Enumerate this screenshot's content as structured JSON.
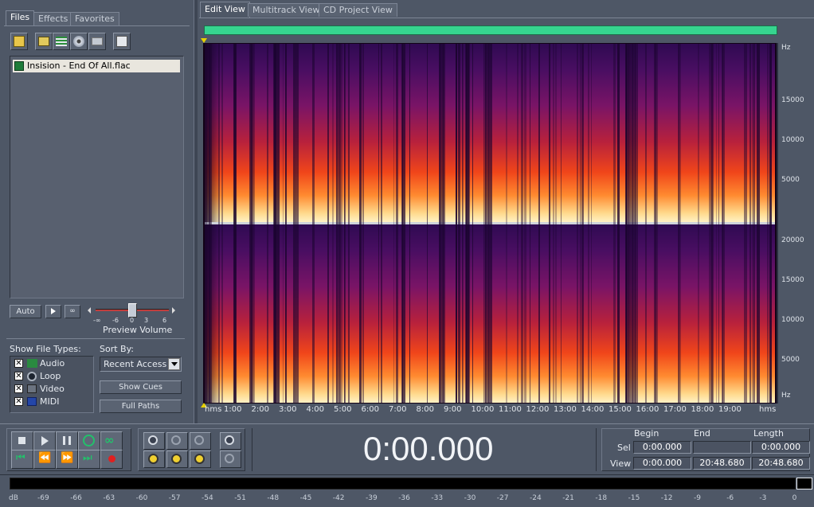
{
  "left_panel": {
    "tabs": [
      "Files",
      "Effects",
      "Favorites"
    ],
    "toolbar_icons": [
      "open-file-icon",
      "close-file-icon",
      "insert-into-multitrack-icon",
      "import-cd-icon",
      "edit-file-icon",
      "auto-play-icon"
    ],
    "files": [
      {
        "name": "Insision - End Of All.flac",
        "type_icon": "audio-waveform-icon"
      }
    ],
    "auto_button": "Auto",
    "preview_volume_label": "Preview Volume",
    "volume_scale": [
      "-∞",
      "-6",
      "0",
      "3",
      "6"
    ],
    "show_file_types_label": "Show File Types:",
    "file_types": [
      {
        "label": "Audio",
        "checked": true,
        "icon": "audio-type-icon"
      },
      {
        "label": "Loop",
        "checked": true,
        "icon": "loop-type-icon"
      },
      {
        "label": "Video",
        "checked": true,
        "icon": "video-type-icon"
      },
      {
        "label": "MIDI",
        "checked": true,
        "icon": "midi-type-icon"
      }
    ],
    "sort_by_label": "Sort By:",
    "sort_by_value": "Recent Access",
    "show_cues_button": "Show Cues",
    "full_paths_button": "Full Paths"
  },
  "view_tabs": [
    "Edit View",
    "Multitrack View",
    "CD Project View"
  ],
  "active_view": "Edit View",
  "spectrogram": {
    "freq_unit": "Hz",
    "top_channel_ticks": [
      "15000",
      "10000",
      "5000"
    ],
    "bottom_channel_ticks": [
      "20000",
      "15000",
      "10000",
      "5000"
    ],
    "time_unit": "hms",
    "time_ticks": [
      "1:00",
      "2:00",
      "3:00",
      "4:00",
      "5:00",
      "6:00",
      "7:00",
      "8:00",
      "9:00",
      "10:00",
      "11:00",
      "12:00",
      "13:00",
      "14:00",
      "15:00",
      "16:00",
      "17:00",
      "18:00",
      "19:00"
    ]
  },
  "transport": {
    "buttons": [
      "stop",
      "play",
      "pause",
      "play-to-end",
      "loop",
      "go-to-beginning",
      "rewind",
      "fast-forward",
      "go-to-end",
      "record"
    ]
  },
  "zoom": {
    "buttons": [
      "zoom-in-horizontal",
      "zoom-out-horizontal",
      "zoom-out-full",
      "zoom-in-vertical",
      "zoom-to-left",
      "zoom-to-right",
      "zoom-to-selection",
      "zoom-out-vertical"
    ]
  },
  "time_display": "0:00.000",
  "selection": {
    "headers": [
      "Begin",
      "End",
      "Length"
    ],
    "sel_label": "Sel",
    "view_label": "View",
    "sel": {
      "begin": "0:00.000",
      "end": "",
      "length": "0:00.000"
    },
    "view": {
      "begin": "0:00.000",
      "end": "20:48.680",
      "length": "20:48.680"
    }
  },
  "level_meter": {
    "unit": "dB",
    "ticks": [
      "-69",
      "-66",
      "-63",
      "-60",
      "-57",
      "-54",
      "-51",
      "-48",
      "-45",
      "-42",
      "-39",
      "-36",
      "-33",
      "-30",
      "-27",
      "-24",
      "-21",
      "-18",
      "-15",
      "-12",
      "-9",
      "-6",
      "-3",
      "0"
    ]
  },
  "colors": {
    "panel": "#4e5766",
    "progress": "#36d48f",
    "spec_low": "#ffe5a0",
    "spec_mid": "#ff3a14",
    "spec_high": "#2a0a4a"
  }
}
